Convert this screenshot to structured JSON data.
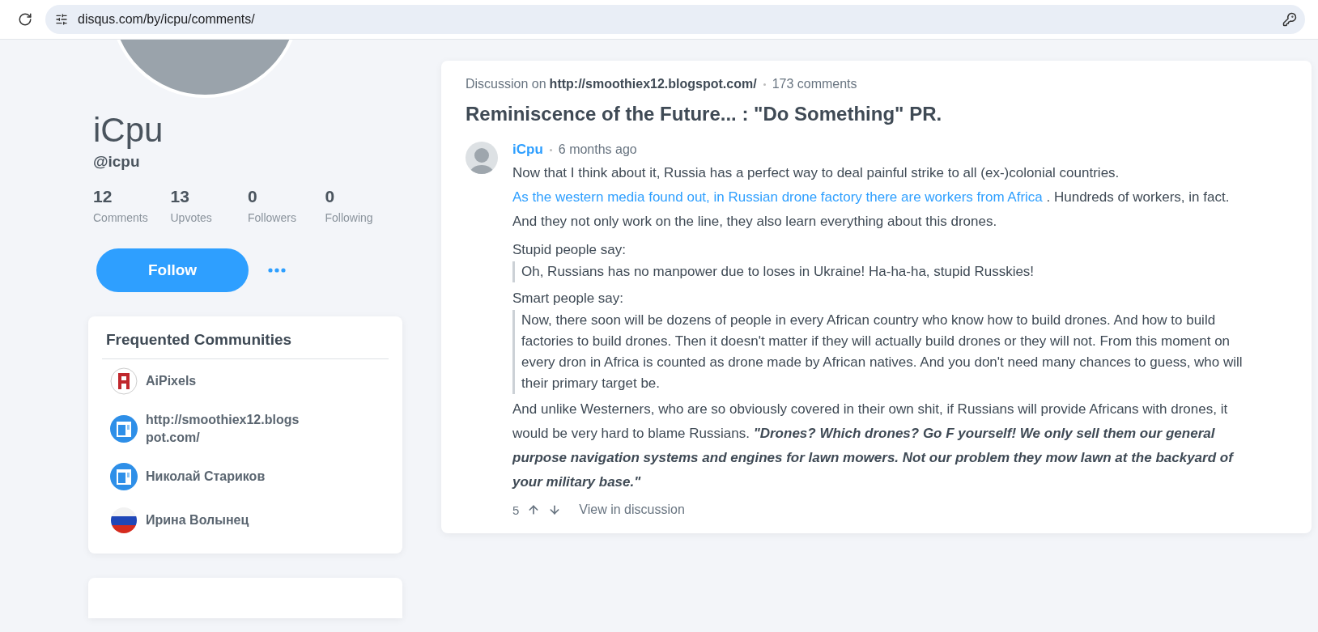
{
  "browser": {
    "url": "disqus.com/by/icpu/comments/"
  },
  "profile": {
    "name": "iCpu",
    "handle": "@icpu",
    "stats": [
      {
        "value": "12",
        "label": "Comments"
      },
      {
        "value": "13",
        "label": "Upvotes"
      },
      {
        "value": "0",
        "label": "Followers"
      },
      {
        "value": "0",
        "label": "Following"
      }
    ],
    "follow_button": "Follow"
  },
  "communities": {
    "title": "Frequented Communities",
    "items": [
      {
        "name": "AiPixels",
        "kind": "pixel"
      },
      {
        "name": "http://smoothiex12.blogspot.com/",
        "kind": "site"
      },
      {
        "name": "Николай Стариков",
        "kind": "site"
      },
      {
        "name": "Ирина Волынец",
        "kind": "flag"
      }
    ]
  },
  "discussion": {
    "prefix": "Discussion on",
    "site": "http://smoothiex12.blogspot.com/",
    "count": "173 comments",
    "title": "Reminiscence of the Future... : \"Do Something\" PR.",
    "comment": {
      "author": "iCpu",
      "time": "6 months ago",
      "blocks": [
        {
          "kind": "paragraph",
          "segments": [
            {
              "kind": "text",
              "text": "Now that I think about it, Russia has a perfect way to deal painful strike to all (ex-)colonial countries. "
            },
            {
              "kind": "link",
              "text": "As the western media found out, in Russian drone factory there are workers from Africa"
            },
            {
              "kind": "text",
              "text": " . Hundreds of workers, in fact. And they not only work on the line, they also learn everything about this drones."
            }
          ]
        },
        {
          "kind": "label",
          "text": "Stupid people say:"
        },
        {
          "kind": "quote",
          "text": "Oh, Russians has no manpower due to loses in Ukraine! Ha-ha-ha, stupid Russkies!"
        },
        {
          "kind": "label",
          "text": "Smart people say:"
        },
        {
          "kind": "quote",
          "text": "Now, there soon will be dozens of people in every African country who know how to build drones. And how to build factories to build drones. Then it doesn't matter if they will actually build drones or they will not. From this moment on every dron in Africa is counted as drone made by African natives. And you don't need many chances to guess, who will their primary target be."
        },
        {
          "kind": "paragraph",
          "segments": [
            {
              "kind": "text",
              "text": "And unlike Westerners, who are so obviously covered in their own shit, if Russians will provide Africans with drones, it would be very hard to blame Russians. "
            },
            {
              "kind": "emphasis",
              "text": "\"Drones? Which drones? Go F yourself! We only sell them our general purpose navigation systems and engines for lawn mowers. Not our problem they mow lawn at the backyard of your military base.\""
            }
          ]
        }
      ],
      "votes": "5",
      "view_link": "View in discussion"
    }
  }
}
